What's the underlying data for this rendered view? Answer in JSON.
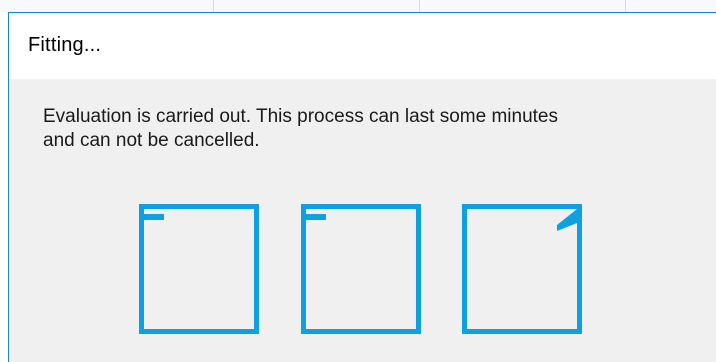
{
  "dialog": {
    "title": "Fitting...",
    "message_line1": "Evaluation is carried out. This process can last some minutes",
    "message_line2": "and can not be cancelled."
  },
  "progress_indicator": {
    "type": "busy-squares",
    "count": 3,
    "accent_color": "#0fa0e0"
  },
  "colors": {
    "dialog_background": "#f0f0f0",
    "titlebar_background": "#ffffff",
    "window_border": "#1883d7"
  }
}
